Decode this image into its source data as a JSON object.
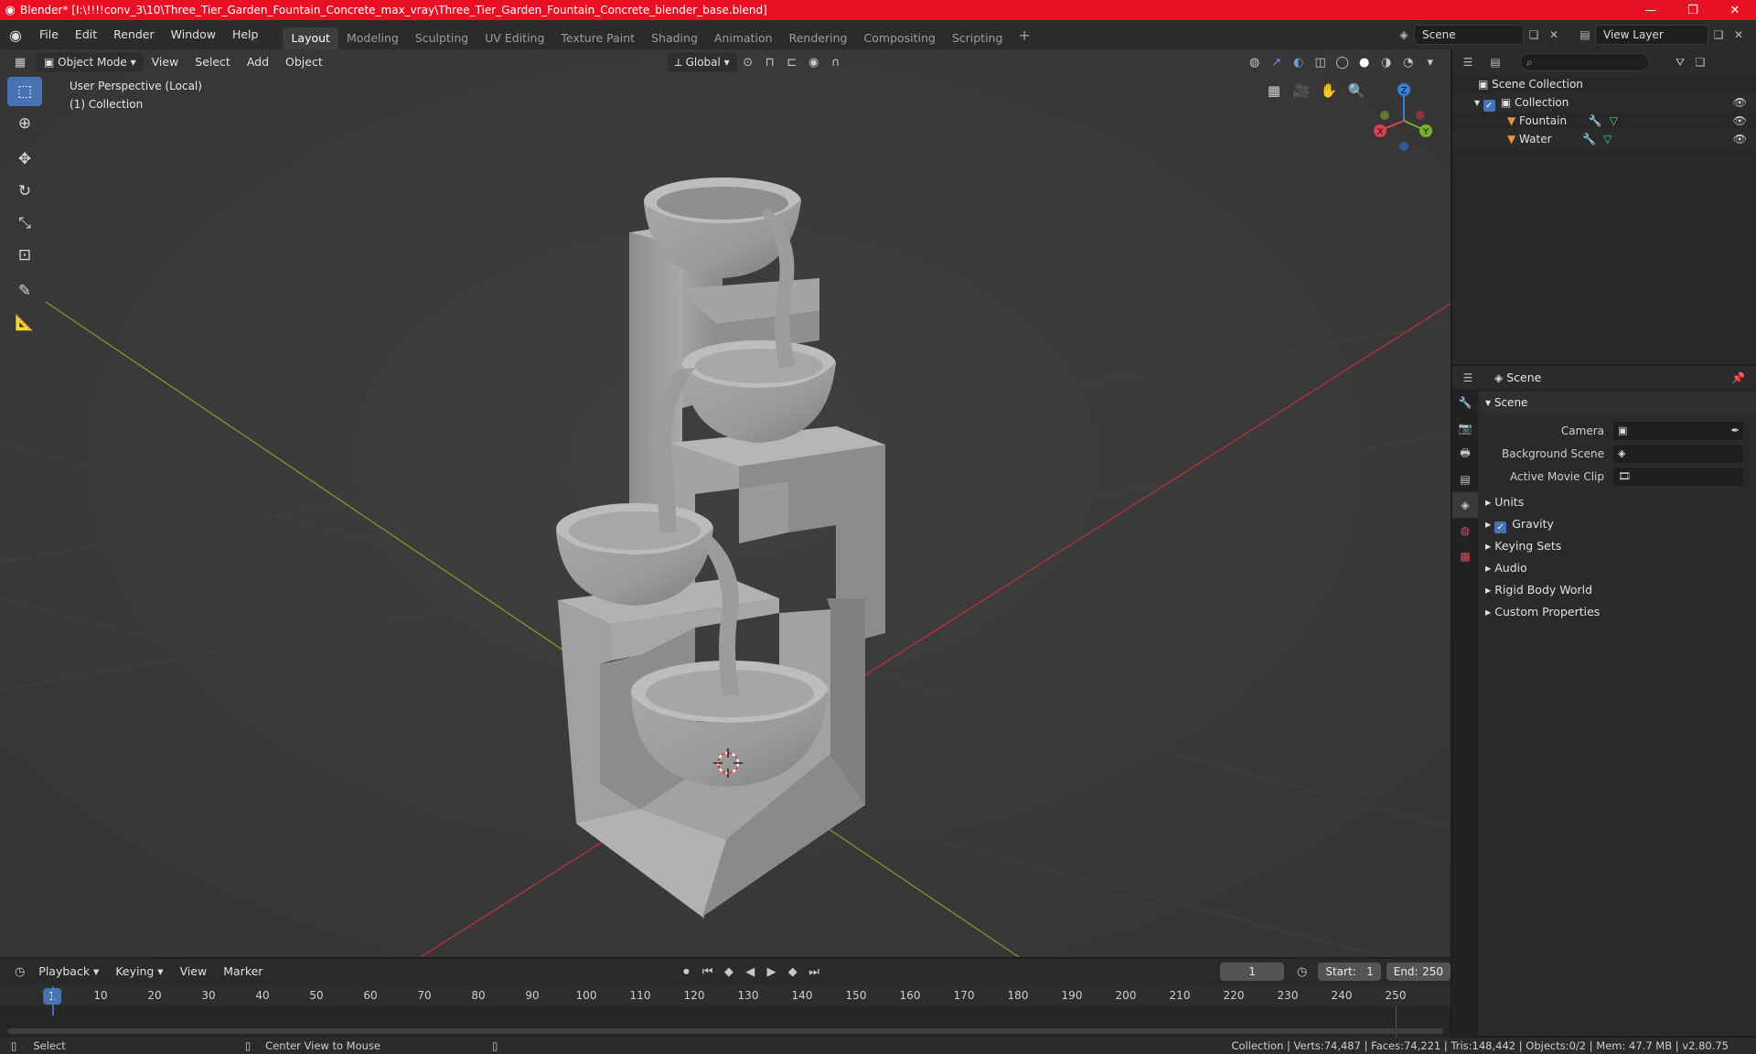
{
  "window": {
    "title": "Blender* [I:\\!!!!conv_3\\10\\Three_Tier_Garden_Fountain_Concrete_max_vray\\Three_Tier_Garden_Fountain_Concrete_blender_base.blend]",
    "minimize": "—",
    "maximize": "❐",
    "close": "✕"
  },
  "menu": {
    "items": [
      "File",
      "Edit",
      "Render",
      "Window",
      "Help"
    ]
  },
  "workspaces": {
    "tabs": [
      "Layout",
      "Modeling",
      "Sculpting",
      "UV Editing",
      "Texture Paint",
      "Shading",
      "Animation",
      "Rendering",
      "Compositing",
      "Scripting"
    ],
    "active": "Layout",
    "add": "+"
  },
  "scene_selector": {
    "value": "Scene"
  },
  "view_layer_selector": {
    "value": "View Layer"
  },
  "viewport": {
    "mode": "Object Mode",
    "menus": [
      "View",
      "Select",
      "Add",
      "Object"
    ],
    "transform_orientation": "Global",
    "info_line1": "User Perspective (Local)",
    "info_line2": "(1) Collection",
    "gizmo": {
      "x": "X",
      "y": "Y",
      "z": "Z"
    }
  },
  "outliner": {
    "root": "Scene Collection",
    "collection": "Collection",
    "objects": [
      "Fountain",
      "Water"
    ]
  },
  "properties": {
    "context": "Scene",
    "panel": "Scene",
    "fields": [
      {
        "label": "Camera",
        "value": ""
      },
      {
        "label": "Background Scene",
        "value": ""
      },
      {
        "label": "Active Movie Clip",
        "value": ""
      }
    ],
    "subpanels": [
      "Units",
      "Gravity",
      "Keying Sets",
      "Audio",
      "Rigid Body World",
      "Custom Properties"
    ],
    "gravity_checked": true
  },
  "timeline": {
    "menus": [
      "Playback",
      "Keying",
      "View",
      "Marker"
    ],
    "current_frame": "1",
    "start_label": "Start:",
    "start": "1",
    "end_label": "End:",
    "end": "250",
    "ticks": [
      "10",
      "20",
      "30",
      "40",
      "50",
      "60",
      "70",
      "80",
      "90",
      "100",
      "110",
      "120",
      "130",
      "140",
      "150",
      "160",
      "170",
      "180",
      "190",
      "200",
      "210",
      "220",
      "230",
      "240",
      "250"
    ],
    "frame_indicator": "1"
  },
  "statusbar": {
    "left_action": "Select",
    "middle_action": "Center View to Mouse",
    "stats": "Collection | Verts:74,487 | Faces:74,221 | Tris:148,442 | Objects:0/2 | Mem: 47.7 MB | v2.80.75"
  }
}
